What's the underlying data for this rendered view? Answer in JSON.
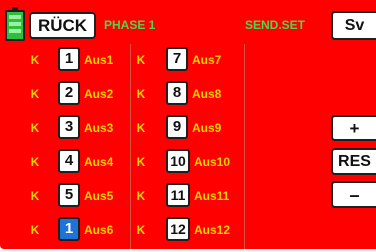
{
  "header": {
    "back_label": "RÜCK",
    "phase_label": "PHASE 1",
    "sendset_label": "SEND.SET",
    "sv_label": "Sv"
  },
  "side_buttons": {
    "plus_label": "+",
    "res_label": "RES",
    "minus_label": "–"
  },
  "left_column": [
    {
      "k": "K",
      "num": "1",
      "label": "Aus1"
    },
    {
      "k": "K",
      "num": "2",
      "label": "Aus2"
    },
    {
      "k": "K",
      "num": "3",
      "label": "Aus3"
    },
    {
      "k": "K",
      "num": "4",
      "label": "Aus4"
    },
    {
      "k": "K",
      "num": "5",
      "label": "Aus5"
    },
    {
      "k": "K",
      "num": "1",
      "label": "Aus6",
      "selected": true
    }
  ],
  "right_column": [
    {
      "k": "K",
      "num": "7",
      "label": "Aus7"
    },
    {
      "k": "K",
      "num": "8",
      "label": "Aus8"
    },
    {
      "k": "K",
      "num": "9",
      "label": "Aus9"
    },
    {
      "k": "K",
      "num": "10",
      "label": "Aus10"
    },
    {
      "k": "K",
      "num": "11",
      "label": "Aus11"
    },
    {
      "k": "K",
      "num": "12",
      "label": "Aus12"
    }
  ],
  "colors": {
    "screen_bg": "#ff0000",
    "label_yellow": "#f2d200",
    "header_green": "#4cd64c",
    "selected_blue": "#1e73d7"
  }
}
